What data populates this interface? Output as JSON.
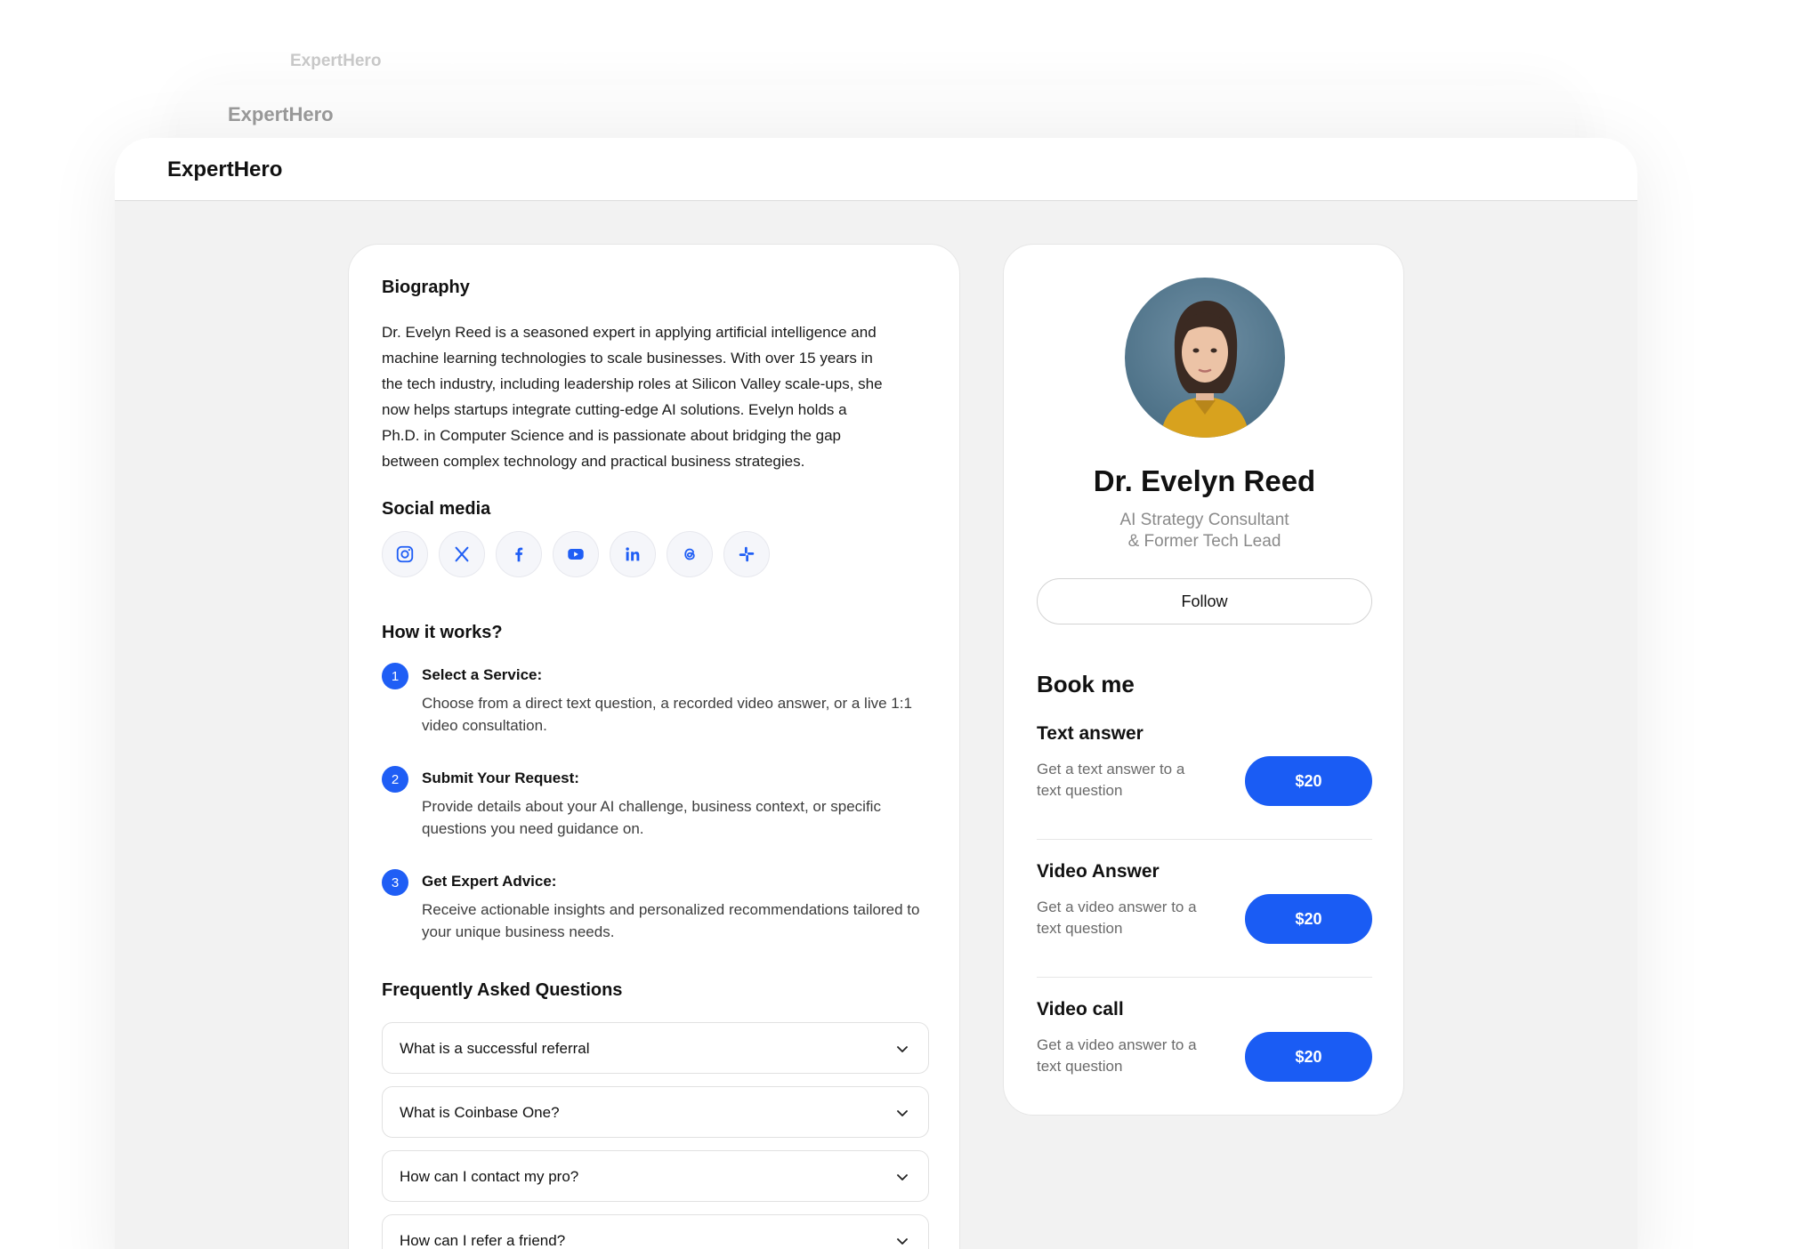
{
  "ghost": {
    "back_title": "ExpertHero",
    "mid_title": "ExpertHero"
  },
  "header": {
    "brand": "ExpertHero"
  },
  "bio": {
    "heading": "Biography",
    "lines": [
      "Dr. Evelyn Reed is a seasoned expert in applying artificial intelligence and",
      "machine learning technologies to scale businesses. With over 15 years in",
      "the tech industry, including leadership roles at Silicon Valley scale-ups, she",
      "now helps startups integrate cutting-edge AI solutions. Evelyn holds a",
      "Ph.D. in Computer Science and is passionate about bridging the gap",
      "between complex technology and practical business strategies."
    ]
  },
  "social": {
    "heading": "Social media",
    "icons": [
      "instagram-icon",
      "x-icon",
      "facebook-icon",
      "youtube-icon",
      "linkedin-icon",
      "threads-icon",
      "slack-icon"
    ]
  },
  "how": {
    "heading": "How it works?",
    "steps": [
      {
        "num": "1",
        "title": "Select a Service:",
        "desc": "Choose from a direct text question, a recorded video answer, or a live 1:1 video consultation."
      },
      {
        "num": "2",
        "title": "Submit Your Request:",
        "desc": "Provide details about your AI challenge, business context, or specific questions you need guidance on."
      },
      {
        "num": "3",
        "title": "Get Expert Advice:",
        "desc": "Receive actionable insights and personalized recommendations tailored to your unique business needs."
      }
    ]
  },
  "faq": {
    "heading": "Frequently Asked Questions",
    "items": [
      "What is a successful referral",
      "What is Coinbase One?",
      "How can I contact my pro?",
      "How can I refer a friend?"
    ]
  },
  "profile": {
    "name": "Dr. Evelyn Reed",
    "subtitle_line1": "AI Strategy Consultant",
    "subtitle_line2": "& Former Tech Lead",
    "follow_label": "Follow"
  },
  "booking": {
    "heading": "Book me",
    "services": [
      {
        "title": "Text answer",
        "desc_line1": "Get a text answer to a",
        "desc_line2": "text question",
        "price": "$20"
      },
      {
        "title": "Video Answer",
        "desc_line1": "Get a video answer to a",
        "desc_line2": "text question",
        "price": "$20"
      },
      {
        "title": "Video call",
        "desc_line1": "Get a video answer to a",
        "desc_line2": "text question",
        "price": "$20"
      }
    ]
  },
  "colors": {
    "accent": "#1a5cf4",
    "background": "#f2f2f2",
    "card": "#ffffff"
  }
}
